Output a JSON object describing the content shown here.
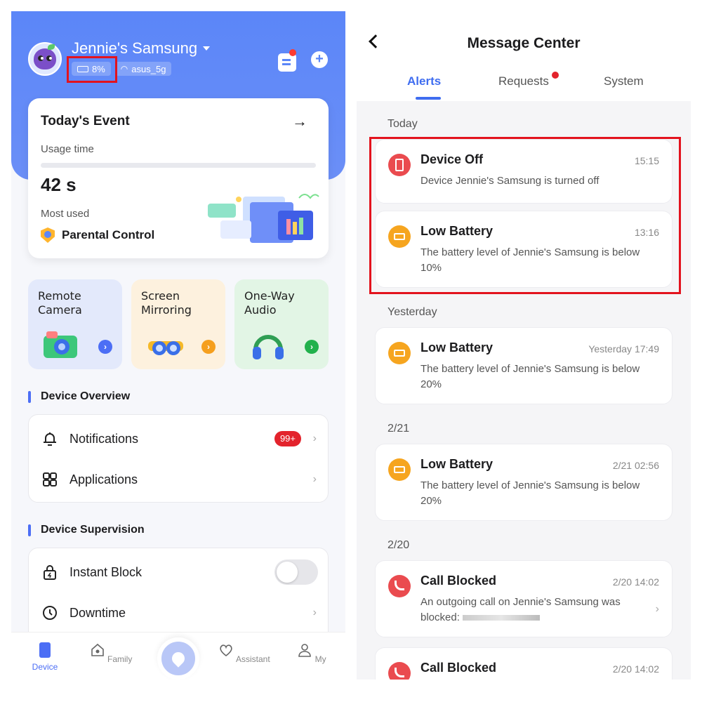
{
  "left": {
    "device_name": "Jennie's Samsung",
    "battery": "8%",
    "wifi": "asus_5g",
    "event": {
      "title": "Today's Event",
      "arrow": "→",
      "usage_label": "Usage time",
      "usage_value": "42 s",
      "most_used_label": "Most used",
      "most_used_app": "Parental Control"
    },
    "features": [
      {
        "label": "Remote\nCamera",
        "icon": "camera-icon"
      },
      {
        "label": "Screen\nMirroring",
        "icon": "binoculars-icon"
      },
      {
        "label": "One-Way\nAudio",
        "icon": "headphones-icon"
      }
    ],
    "overview": {
      "title": "Device Overview",
      "notifications": "Notifications",
      "notifications_badge": "99+",
      "applications": "Applications"
    },
    "supervision": {
      "title": "Device Supervision",
      "instant_block": "Instant Block",
      "downtime": "Downtime"
    },
    "tabs": [
      "Device",
      "Family",
      "",
      "Assistant",
      "My"
    ]
  },
  "right": {
    "title": "Message Center",
    "tabs": [
      "Alerts",
      "Requests",
      "System"
    ],
    "sections": [
      {
        "label": "Today"
      },
      {
        "label": "Yesterday"
      },
      {
        "label": "2/21"
      },
      {
        "label": "2/20"
      }
    ],
    "cards": [
      {
        "title": "Device Off",
        "time": "15:15",
        "body": "Device Jennie's Samsung is turned off"
      },
      {
        "title": "Low Battery",
        "time": "13:16",
        "body": "The battery level of Jennie's Samsung is below 10%"
      },
      {
        "title": "Low Battery",
        "time": "Yesterday 17:49",
        "body": "The battery level of Jennie's Samsung is below 20%"
      },
      {
        "title": "Low Battery",
        "time": "2/21 02:56",
        "body": "The battery level of Jennie's Samsung is below 20%"
      },
      {
        "title": "Call Blocked",
        "time": "2/20 14:02",
        "body": "An outgoing call on Jennie's Samsung was blocked:"
      },
      {
        "title": "Call Blocked",
        "time": "2/20 14:02",
        "body": ""
      }
    ]
  },
  "colors": {
    "accent": "#4c6ef5",
    "hero": "#5b86f8",
    "alert_red": "#ea4b4f",
    "alert_orange": "#f6a51f",
    "highlight": "#e3131e"
  }
}
